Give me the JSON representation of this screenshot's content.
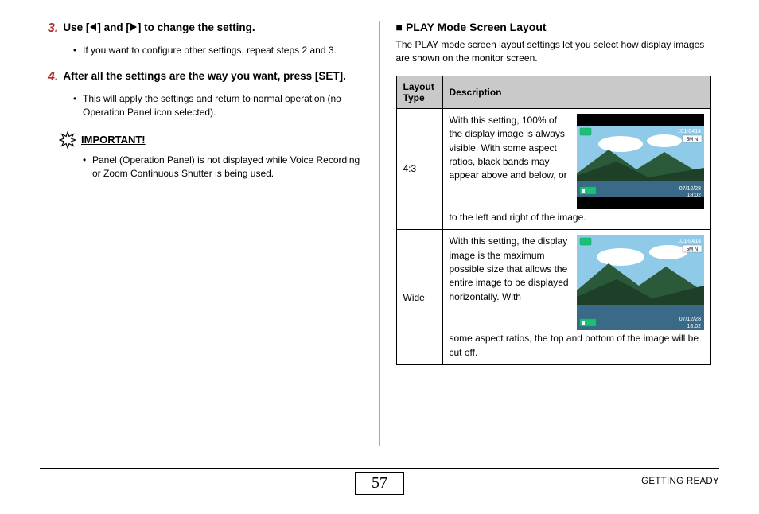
{
  "left": {
    "step3": {
      "num": "3.",
      "text_before": "Use [",
      "text_mid": "] and [",
      "text_after": "] to change the setting."
    },
    "step3_bullet": "If you want to configure other settings, repeat steps 2 and 3.",
    "step4": {
      "num": "4.",
      "text": "After all the settings are the way you want, press [SET]."
    },
    "step4_bullet": "This will apply the settings and return to normal operation (no Operation Panel icon selected).",
    "important_label": "IMPORTANT!",
    "important_bullet": "Panel (Operation Panel) is not displayed while Voice Recording or Zoom Continuous Shutter is being used."
  },
  "right": {
    "heading": "PLAY Mode Screen Layout",
    "intro": "The PLAY mode screen layout settings let you select how display images are shown on the monitor screen.",
    "table": {
      "headers": {
        "c1": "Layout Type",
        "c2": "Description"
      },
      "rows": [
        {
          "type": "4:3",
          "desc_side": "With this setting, 100% of the display image is always visible. With some aspect ratios, black bands may appear above and below, or",
          "desc_tail": "to the left and right of the image.",
          "overlay": {
            "folder": "101-0414",
            "size": "5M N",
            "date": "07/12/28",
            "time": "18:02"
          }
        },
        {
          "type": "Wide",
          "desc_side": "With this setting, the display image is the maximum possible size that allows the entire image to be displayed horizontally. With",
          "desc_tail": "some aspect ratios, the top and bottom of the image will be cut off.",
          "overlay": {
            "folder": "101-0414",
            "size": "5M N",
            "date": "07/12/28",
            "time": "18:02"
          }
        }
      ]
    }
  },
  "footer": {
    "page": "57",
    "section": "GETTING READY"
  }
}
